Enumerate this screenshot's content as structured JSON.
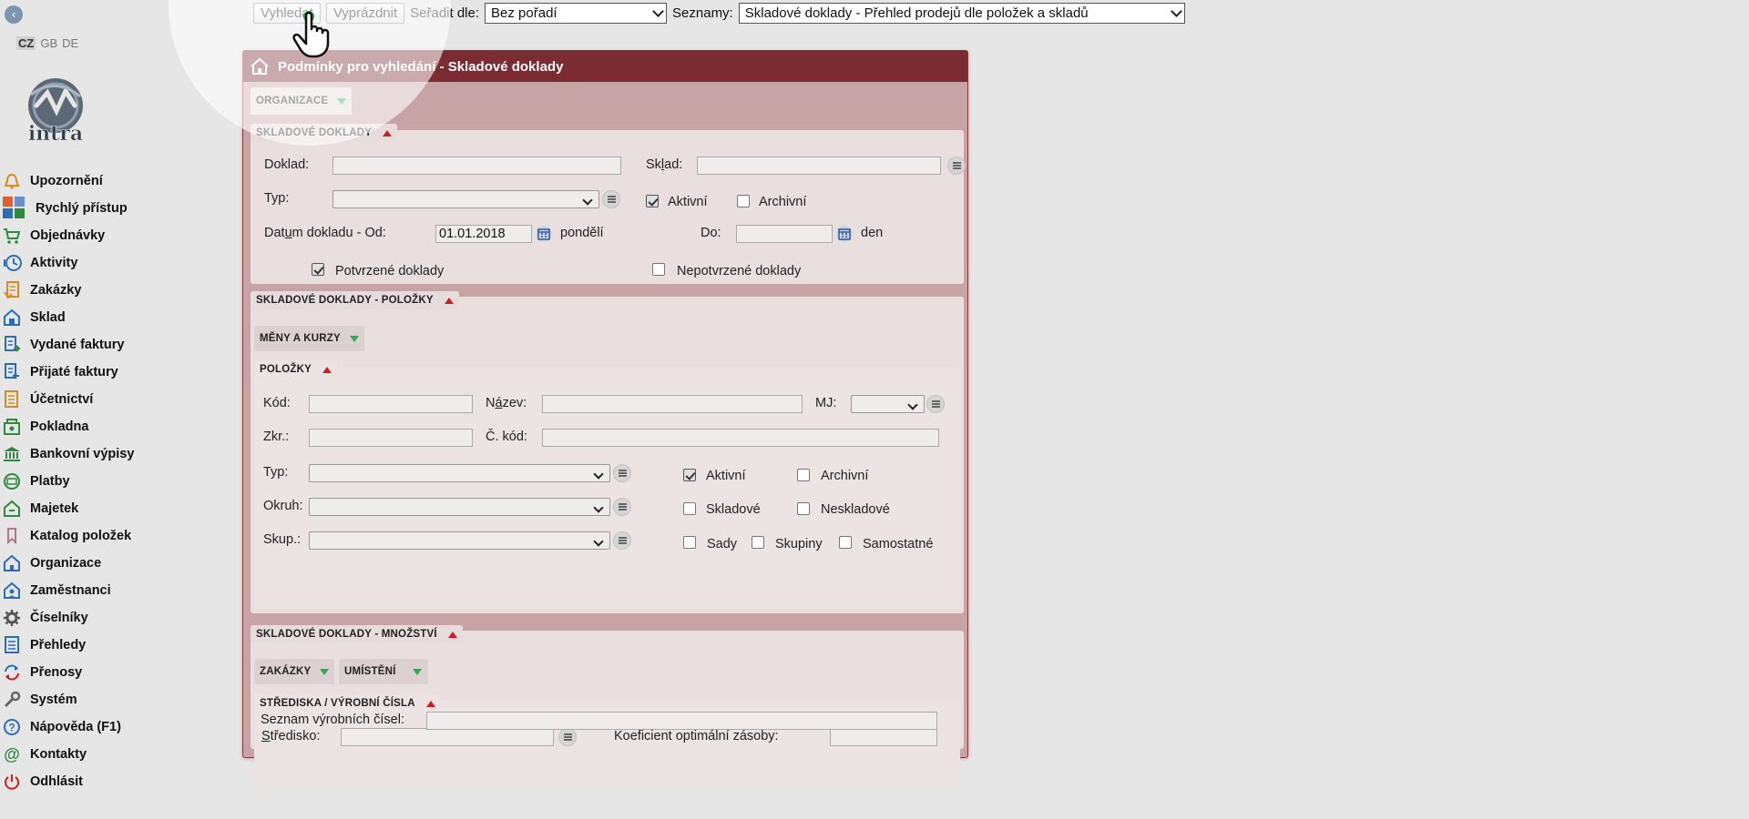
{
  "sidebar": {
    "back_icon": "chevron-left-icon",
    "languages": [
      "CZ",
      "GB",
      "DE"
    ],
    "logo_text": "intra",
    "items": [
      {
        "label": "Upozornění",
        "icon": "bell-icon",
        "color": "#e08a1e"
      },
      {
        "label": "Rychlý přístup",
        "icon": "quick-access-icon",
        "color": "#e0602b"
      },
      {
        "label": "Objednávky",
        "icon": "cart-icon",
        "color": "#2e8b3e"
      },
      {
        "label": "Aktivity",
        "icon": "clock-icon",
        "color": "#2a6ebb"
      },
      {
        "label": "Zakázky",
        "icon": "document-icon",
        "color": "#e08a1e"
      },
      {
        "label": "Sklad",
        "icon": "warehouse-icon",
        "color": "#2a6ebb"
      },
      {
        "label": "Vydané faktury",
        "icon": "invoice-out-icon",
        "color": "#2a6ebb"
      },
      {
        "label": "Přijaté faktury",
        "icon": "invoice-in-icon",
        "color": "#2a6ebb"
      },
      {
        "label": "Účetnictví",
        "icon": "ledger-icon",
        "color": "#c8901e"
      },
      {
        "label": "Pokladna",
        "icon": "cash-icon",
        "color": "#2e8b3e"
      },
      {
        "label": "Bankovní výpisy",
        "icon": "bank-icon",
        "color": "#2e8b3e"
      },
      {
        "label": "Platby",
        "icon": "payment-icon",
        "color": "#2e8b3e"
      },
      {
        "label": "Majetek",
        "icon": "property-icon",
        "color": "#2e8b3e"
      },
      {
        "label": "Katalog položek",
        "icon": "tag-icon",
        "color": "#b07a8a"
      },
      {
        "label": "Organizace",
        "icon": "organization-icon",
        "color": "#2a6ebb"
      },
      {
        "label": "Zaměstnanci",
        "icon": "employees-icon",
        "color": "#2a6ebb"
      },
      {
        "label": "Číselníky",
        "icon": "gear-icon",
        "color": "#555555"
      },
      {
        "label": "Přehledy",
        "icon": "list-icon",
        "color": "#2a6ebb"
      },
      {
        "label": "Přenosy",
        "icon": "transfer-icon",
        "color": "#2a6ebb"
      },
      {
        "label": "Systém",
        "icon": "wrench-icon",
        "color": "#666666"
      },
      {
        "label": "Nápověda (F1)",
        "icon": "help-icon",
        "color": "#2a6ebb"
      },
      {
        "label": "Kontakty",
        "icon": "at-icon",
        "color": "#2e8b3e"
      },
      {
        "label": "Odhlásit",
        "icon": "power-icon",
        "color": "#d01c1c"
      }
    ]
  },
  "toolbar": {
    "search_label": "Vyhledat",
    "clear_label": "Vyprázdnit",
    "sort_label": "Seřadit dle:",
    "sort_value": "Bez pořadí",
    "lists_label": "Seznamy:",
    "lists_value": "Skladové doklady - Přehled prodejů dle položek a skladů"
  },
  "panel": {
    "title": "Podmínky pro vyhledání - Skladové doklady",
    "tab_organizace": "ORGANIZACE",
    "sec1": {
      "title": "SKLADOVÉ DOKLADY",
      "doklad_label": "Doklad:",
      "doklad_value": "",
      "sklad_label": "Sklad:",
      "sklad_value": "",
      "typ_label": "Typ:",
      "typ_value": "",
      "aktivni_label": "Aktivní",
      "aktivni_checked": true,
      "archivni_label": "Archivní",
      "archivni_checked": false,
      "datum_label": "Datum dokladu - Od:",
      "datum_od_value": "01.01.2018",
      "datum_od_day": "pondělí",
      "do_label": "Do:",
      "datum_do_value": "",
      "datum_do_unit": "den",
      "potvrzene_label": "Potvrzené doklady",
      "potvrzene_checked": true,
      "nepotvrzene_label": "Nepotvrzené doklady",
      "nepotvrzene_checked": false
    },
    "sec2": {
      "title": "SKLADOVÉ DOKLADY - POLOŽKY",
      "tab_meny": "MĚNY A KURZY",
      "polozky_title": "POLOŽKY",
      "kod_label": "Kód:",
      "kod_value": "",
      "nazev_label": "Název:",
      "nazev_value": "",
      "mj_label": "MJ:",
      "mj_value": "",
      "zkr_label": "Zkr.:",
      "zkr_value": "",
      "ckod_label": "Č. kód:",
      "ckod_value": "",
      "typ_label": "Typ:",
      "okruh_label": "Okruh:",
      "skup_label": "Skup.:",
      "aktivni_label": "Aktivní",
      "aktivni_checked": true,
      "archivni_label": "Archivní",
      "skladove_label": "Skladové",
      "neskladove_label": "Neskladové",
      "sady_label": "Sady",
      "skupiny_label": "Skupiny",
      "samostatne_label": "Samostatné"
    },
    "sec3": {
      "title": "SKLADOVÉ DOKLADY - MNOŽSTVÍ",
      "tab_zakazky": "ZAKÁZKY",
      "tab_umisteni": "UMÍSTĚNÍ",
      "strediska_title": "STŘEDISKA / VÝROBNÍ ČÍSLA",
      "stredisko_label": "Středisko:",
      "stredisko_value": "",
      "koef_label": "Koeficient optimální zásoby:",
      "koef_value": "",
      "seznam_label": "Seznam výrobních čísel:",
      "seznam_value": ""
    }
  },
  "colors": {
    "panel_header": "#7b2c32",
    "panel_body": "#c7a3a5",
    "expand_arrow": "#2bae4e",
    "collapse_arrow": "#d01c1c"
  }
}
